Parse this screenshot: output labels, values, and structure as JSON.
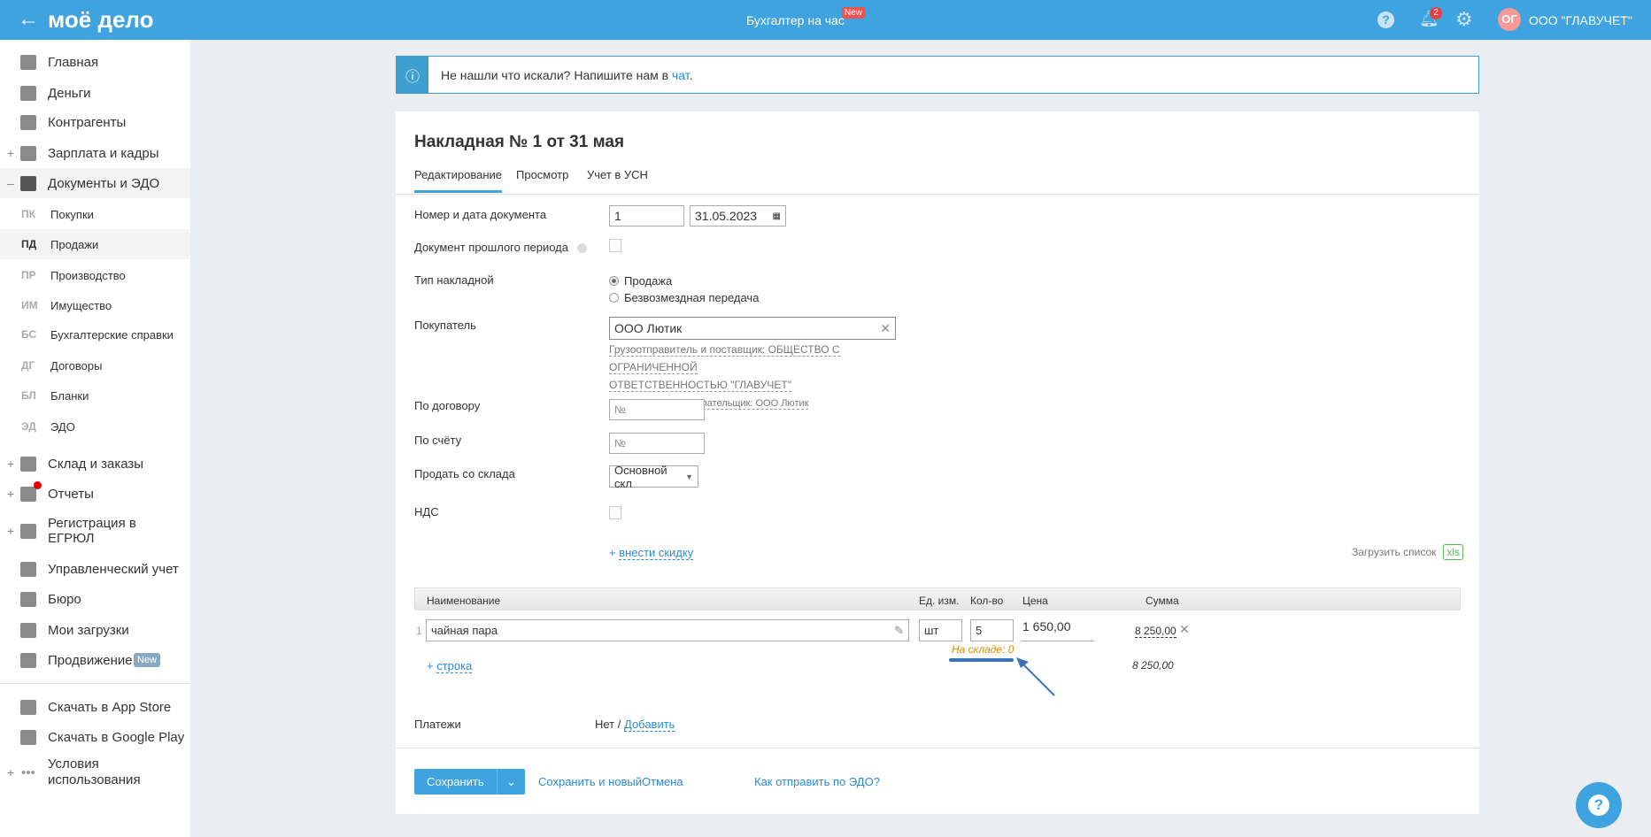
{
  "header": {
    "logo": "моё дело",
    "center": "Бухгалтер на час",
    "new_badge": "New",
    "notif_count": "2",
    "avatar": "ОГ",
    "company": "ООО \"ГЛАВУЧЕТ\""
  },
  "sidebar": {
    "items": [
      {
        "label": "Главная",
        "plus": ""
      },
      {
        "label": "Деньги",
        "plus": ""
      },
      {
        "label": "Контрагенты",
        "plus": ""
      },
      {
        "label": "Зарплата и кадры",
        "plus": "+"
      },
      {
        "label": "Документы и ЭДО",
        "plus": "–"
      }
    ],
    "sub": [
      {
        "ab": "ПК",
        "label": "Покупки"
      },
      {
        "ab": "ПД",
        "label": "Продажи"
      },
      {
        "ab": "ПР",
        "label": "Производство"
      },
      {
        "ab": "ИМ",
        "label": "Имущество"
      },
      {
        "ab": "БС",
        "label": "Бухгалтерские справки"
      },
      {
        "ab": "ДГ",
        "label": "Договоры"
      },
      {
        "ab": "БЛ",
        "label": "Бланки"
      },
      {
        "ab": "ЭД",
        "label": "ЭДО"
      }
    ],
    "items2": [
      {
        "label": "Склад и заказы",
        "plus": "+"
      },
      {
        "label": "Отчеты",
        "plus": "+"
      },
      {
        "label": "Регистрация в ЕГРЮЛ",
        "plus": "+"
      },
      {
        "label": "Управленческий учет",
        "plus": ""
      },
      {
        "label": "Бюро",
        "plus": ""
      },
      {
        "label": "Мои загрузки",
        "plus": ""
      },
      {
        "label": "Продвижение",
        "plus": "",
        "badge": "New"
      },
      {
        "label": "Скачать в App Store",
        "plus": ""
      },
      {
        "label": "Скачать в Google Play",
        "plus": ""
      },
      {
        "label": "Условия использования",
        "plus": "+"
      }
    ]
  },
  "banner": {
    "text": "Не нашли что искали? Напишите нам в ",
    "link": "чат",
    "dot": "."
  },
  "doc": {
    "title": "Накладная № 1 от 31 мая",
    "tabs": [
      "Редактирование",
      "Просмотр",
      "Учет в УСН"
    ],
    "labels": {
      "number": "Номер и дата документа",
      "past": "Документ прошлого периода",
      "type": "Тип накладной",
      "buyer": "Покупатель",
      "contract": "По договору",
      "invoice": "По счёту",
      "warehouse": "Продать со склада",
      "vat": "НДС",
      "payments": "Платежи"
    },
    "number": "1",
    "date": "31.05.2023",
    "type_options": [
      "Продажа",
      "Безвозмездная передача"
    ],
    "buyer": "ООО Лютик",
    "shipper": "Грузоотправитель и поставщик: ОБЩЕСТВО С ОГРАНИЧЕННОЙ",
    "shipper2": "ОТВЕТСТВЕННОСТЬЮ \"ГЛАВУЧЕТ\"",
    "consignee": "Грузополучатель и плательщик: ООО Лютик",
    "contract_ph": "№",
    "invoice_ph": "№",
    "warehouse": "Основной скл",
    "discount": "внести скидку",
    "upload": "Загрузить список",
    "xls": "xls",
    "columns": [
      "Наименование",
      "Ед. изм.",
      "Кол-во",
      "Цена",
      "Сумма"
    ],
    "row": {
      "n": "1",
      "name": "чайная пара",
      "unit": "шт",
      "qty": "5",
      "price": "1 650,00",
      "sum": "8 250,00"
    },
    "stock": "На складе: 0",
    "add_row": "строка",
    "total": "8 250,00",
    "pay_none": "Нет /",
    "pay_add": "Добавить"
  },
  "footer": {
    "save": "Сохранить",
    "save_new": "Сохранить и новый",
    "cancel": "Отмена",
    "edo": "Как отправить по ЭДО?"
  }
}
